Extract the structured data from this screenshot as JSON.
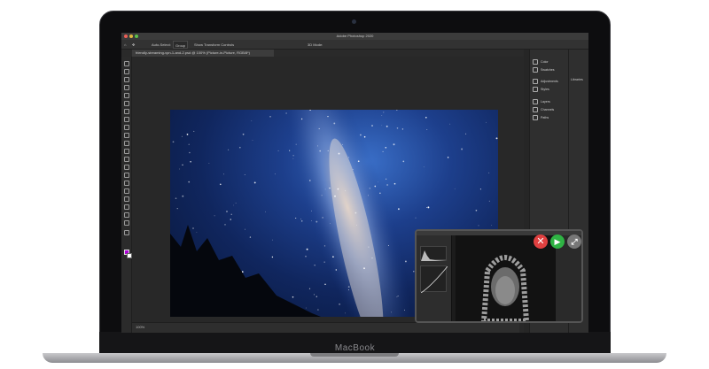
{
  "device": {
    "brand_label": "MacBook"
  },
  "app": {
    "title": "Adobe Photoshop 2020",
    "options_bar": {
      "auto_select_label": "Auto-Select:",
      "auto_select_value": "Group",
      "show_transform_label": "Show Transform Controls",
      "mode_3d_label": "3D Mode:"
    },
    "document_tab": "friendly-streaming-vpn-1-and-2.psd @ 100% (Picture-in-Picture, RGB/8*)",
    "status_bar": {
      "zoom": "100%"
    },
    "panels": [
      {
        "label": "Color",
        "icon": "color-icon"
      },
      {
        "label": "Swatches",
        "icon": "swatches-icon"
      },
      {
        "label": "Adjustments",
        "icon": "adjustments-icon"
      },
      {
        "label": "Styles",
        "icon": "styles-icon"
      },
      {
        "label": "Layers",
        "icon": "layers-icon"
      },
      {
        "label": "Channels",
        "icon": "channels-icon"
      },
      {
        "label": "Paths",
        "icon": "paths-icon"
      }
    ],
    "libraries_label": "Libraries",
    "foreground_color": "#b000d8",
    "background_color": "#ffffff"
  },
  "pip": {
    "close_glyph": "✕",
    "play_glyph": "▶",
    "expand_glyph": "⤢"
  }
}
